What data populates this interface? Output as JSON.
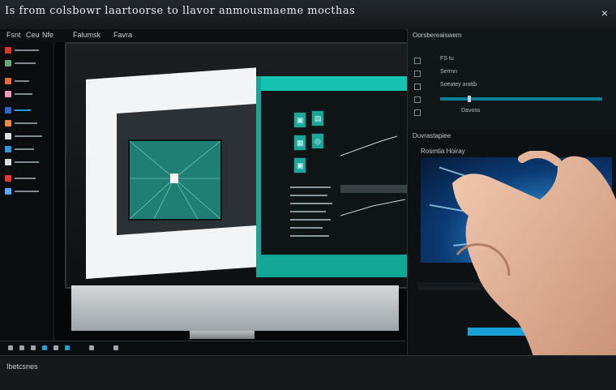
{
  "window": {
    "title": "Is from  colsbowr laartoorse to llavor  anmousmaeme mocthas",
    "close_glyph": "×"
  },
  "menubar": {
    "items": [
      "Fsnt",
      "Ceu",
      "Nfe",
      "Falumsk",
      "Favra"
    ]
  },
  "monitor": {
    "brand_glyph": ""
  },
  "properties_panel": {
    "header": "Oorsbereaiswem",
    "rows": [
      "FS tu",
      "Serrnn",
      "Soeatey aratib",
      "",
      "",
      "Davoss"
    ]
  },
  "preview_panel": {
    "header": "Duvrastapiee",
    "subheader": "Rosmtia Hoiray"
  },
  "status_bar": {
    "text": "Ibetcsnes"
  },
  "colors": {
    "accent_teal": "#15c3b2",
    "accent_blue": "#1aa0d6"
  }
}
